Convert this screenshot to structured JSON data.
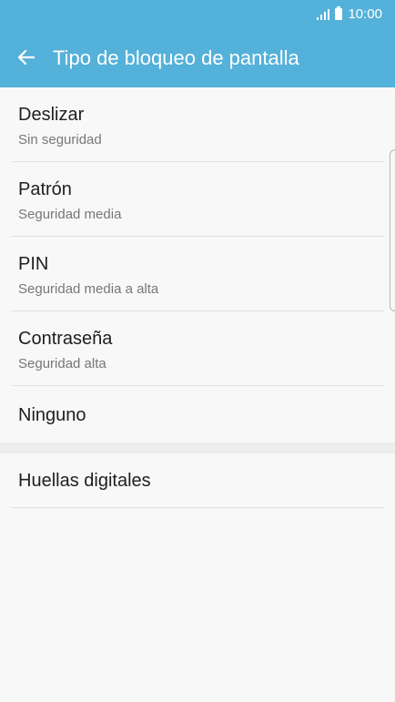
{
  "status_bar": {
    "time": "10:00"
  },
  "app_bar": {
    "title": "Tipo de bloqueo de pantalla"
  },
  "options": [
    {
      "title": "Deslizar",
      "subtitle": "Sin seguridad"
    },
    {
      "title": "Patrón",
      "subtitle": "Seguridad media"
    },
    {
      "title": "PIN",
      "subtitle": "Seguridad media a alta"
    },
    {
      "title": "Contraseña",
      "subtitle": "Seguridad alta"
    },
    {
      "title": "Ninguno"
    }
  ],
  "fingerprint": {
    "title": "Huellas digitales"
  },
  "colors": {
    "accent": "#54b1d9",
    "background": "#f8f8f8"
  },
  "icons": [
    "signal-icon",
    "battery-icon",
    "back-arrow-icon"
  ]
}
